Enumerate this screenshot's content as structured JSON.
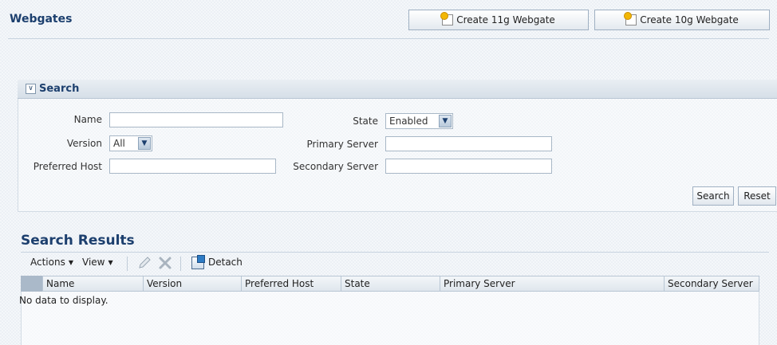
{
  "header": {
    "title": "Webgates",
    "create_11g_label": "Create 11g Webgate",
    "create_10g_label": "Create 10g Webgate"
  },
  "search": {
    "title": "Search",
    "name_label": "Name",
    "name_value": "",
    "version_label": "Version",
    "version_value": "All",
    "preferred_host_label": "Preferred Host",
    "preferred_host_value": "",
    "state_label": "State",
    "state_value": "Enabled",
    "primary_server_label": "Primary Server",
    "primary_server_value": "",
    "secondary_server_label": "Secondary Server",
    "secondary_server_value": "",
    "search_button": "Search",
    "reset_button": "Reset"
  },
  "results": {
    "title": "Search Results",
    "actions_label": "Actions",
    "view_label": "View",
    "detach_label": "Detach",
    "columns": [
      "Name",
      "Version",
      "Preferred Host",
      "State",
      "Primary Server",
      "Secondary Server"
    ],
    "empty_message": "No data to display."
  },
  "icons": {
    "create": "add-page-icon",
    "edit": "pencil-icon",
    "delete": "delete-x-icon",
    "detach": "detach-icon",
    "dropdown": "chevron-down-icon",
    "disclose": "chevron-down-icon"
  },
  "colors": {
    "title": "#1c3f6e",
    "border": "#a8b7c6"
  }
}
